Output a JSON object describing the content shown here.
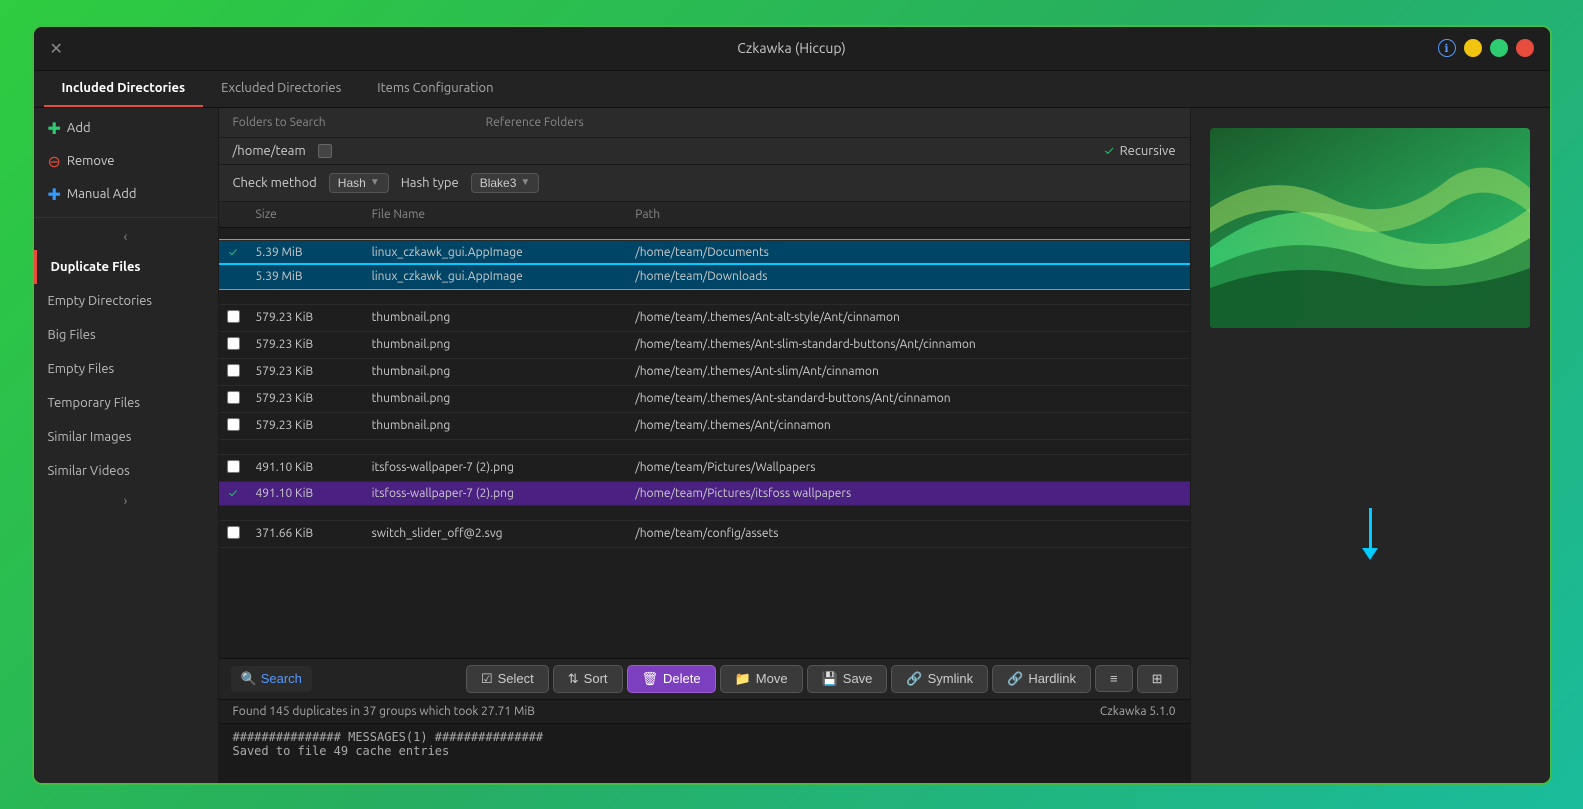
{
  "window": {
    "title": "Czkawka (Hiccup)",
    "version": "Czkawka 5.1.0"
  },
  "titlebar": {
    "title": "Czkawka (Hiccup)",
    "close_label": "✕",
    "controls": [
      "✕",
      "ℹ",
      "●",
      "●",
      "●"
    ]
  },
  "tabs": [
    {
      "id": "included",
      "label": "Included Directories",
      "active": true
    },
    {
      "id": "excluded",
      "label": "Excluded Directories",
      "active": false
    },
    {
      "id": "items",
      "label": "Items Configuration",
      "active": false
    }
  ],
  "sidebar_actions": [
    {
      "id": "add",
      "label": "Add",
      "icon": "+",
      "icon_color": "#2ecc71"
    },
    {
      "id": "remove",
      "label": "Remove",
      "icon": "−",
      "icon_color": "#e74c3c"
    },
    {
      "id": "manual_add",
      "label": "Manual Add",
      "icon": "+",
      "icon_color": "#3399ff"
    }
  ],
  "sidebar_nav": [
    {
      "id": "duplicate_files",
      "label": "Duplicate Files",
      "active": true
    },
    {
      "id": "empty_directories",
      "label": "Empty Directories",
      "active": false
    },
    {
      "id": "big_files",
      "label": "Big Files",
      "active": false
    },
    {
      "id": "empty_files",
      "label": "Empty Files",
      "active": false
    },
    {
      "id": "temporary_files",
      "label": "Temporary Files",
      "active": false
    },
    {
      "id": "similar_images",
      "label": "Similar Images",
      "active": false
    },
    {
      "id": "similar_videos",
      "label": "Similar Videos",
      "active": false
    }
  ],
  "dir_headers": {
    "folders_to_search": "Folders to Search",
    "reference_folders": "Reference Folders"
  },
  "directory_entry": {
    "path": "/home/team",
    "recursive_label": "Recursive",
    "recursive_checked": true
  },
  "check_method": {
    "label": "Check method",
    "method_value": "Hash",
    "hash_type_label": "Hash type",
    "hash_type_value": "Blake3"
  },
  "table_headers": {
    "size": "Size",
    "file_name": "File Name",
    "path": "Path"
  },
  "file_rows": [
    {
      "group": 1,
      "rows": [
        {
          "checked": true,
          "size": "5.39 MiB",
          "file_name": "linux_czkawk_gui.AppImage",
          "path": "/home/team/Documents",
          "selected_cyan": true
        },
        {
          "checked": false,
          "size": "5.39 MiB",
          "file_name": "linux_czkawk_gui.AppImage",
          "path": "/home/team/Downloads",
          "selected_cyan": true
        }
      ]
    },
    {
      "group": 2,
      "rows": [
        {
          "checked": false,
          "size": "579.23 KiB",
          "file_name": "thumbnail.png",
          "path": "/home/team/.themes/Ant-alt-style/Ant/cinnamon",
          "selected_cyan": false
        },
        {
          "checked": false,
          "size": "579.23 KiB",
          "file_name": "thumbnail.png",
          "path": "/home/team/.themes/Ant-slim-standard-buttons/Ant/cinnamon",
          "selected_cyan": false
        },
        {
          "checked": false,
          "size": "579.23 KiB",
          "file_name": "thumbnail.png",
          "path": "/home/team/.themes/Ant-slim/Ant/cinnamon",
          "selected_cyan": false
        },
        {
          "checked": false,
          "size": "579.23 KiB",
          "file_name": "thumbnail.png",
          "path": "/home/team/.themes/Ant-standard-buttons/Ant/cinnamon",
          "selected_cyan": false
        },
        {
          "checked": false,
          "size": "579.23 KiB",
          "file_name": "thumbnail.png",
          "path": "/home/team/.themes/Ant/cinnamon",
          "selected_cyan": false
        }
      ]
    },
    {
      "group": 3,
      "rows": [
        {
          "checked": false,
          "size": "491.10 KiB",
          "file_name": "itsfoss-wallpaper-7 (2).png",
          "path": "/home/team/Pictures/Wallpapers",
          "selected_cyan": false
        },
        {
          "checked": true,
          "size": "491.10 KiB",
          "file_name": "itsfoss-wallpaper-7 (2).png",
          "path": "/home/team/Pictures/itsfoss wallpapers",
          "selected_purple": true
        }
      ]
    },
    {
      "group": 4,
      "rows": [
        {
          "checked": false,
          "size": "371.66 KiB",
          "file_name": "switch_slider_off@2.svg",
          "path": "/home/team/config/assets",
          "selected_cyan": false
        }
      ]
    }
  ],
  "toolbar": {
    "search_label": "Search",
    "select_label": "Select",
    "sort_label": "Sort",
    "delete_label": "Delete",
    "move_label": "Move",
    "save_label": "Save",
    "symlink_label": "Symlink",
    "hardlink_label": "Hardlink",
    "extra1_label": "≡",
    "extra2_label": "⊞"
  },
  "status_bar": {
    "message": "Found 145 duplicates in 37 groups which took 27.71 MiB",
    "version": "Czkawka 5.1.0"
  },
  "log": {
    "line1": "############### MESSAGES(1) ###############",
    "line2": "Saved to file 49 cache entries"
  },
  "colors": {
    "accent_red": "#e74c3c",
    "accent_green": "#2ecc71",
    "accent_blue": "#3399ff",
    "cyan": "#00ccff",
    "purple": "#7b3fc0",
    "selected_cyan_bg": "#004466",
    "selected_purple_bg": "#4a2080"
  }
}
